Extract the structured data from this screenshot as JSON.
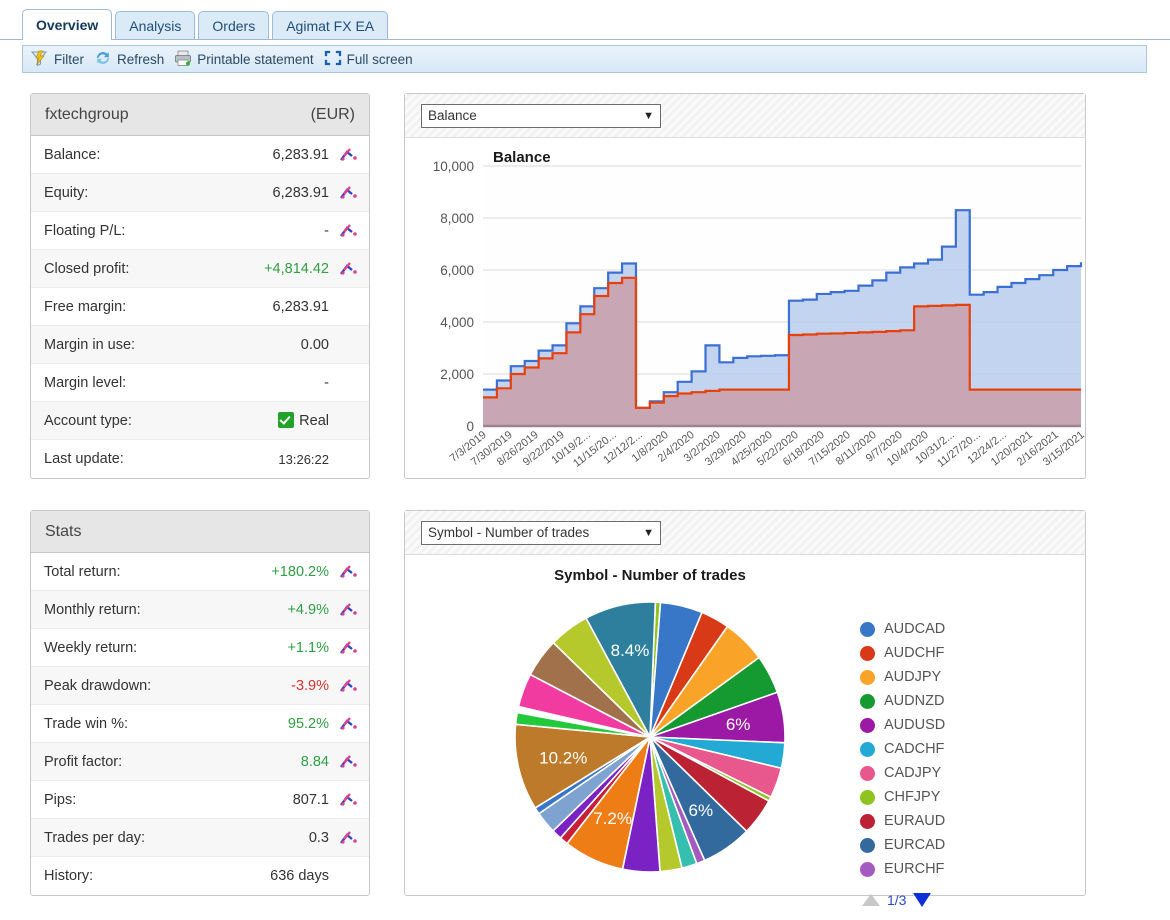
{
  "tabs": [
    {
      "label": "Overview",
      "active": true
    },
    {
      "label": "Analysis",
      "active": false
    },
    {
      "label": "Orders",
      "active": false
    },
    {
      "label": "Agimat FX EA",
      "active": false
    }
  ],
  "toolbar": {
    "filter": "Filter",
    "refresh": "Refresh",
    "printable": "Printable statement",
    "fullscreen": "Full screen"
  },
  "account": {
    "title": "fxtechgroup",
    "currency": "(EUR)",
    "rows": [
      {
        "label": "Balance:",
        "value": "6,283.91",
        "color": "",
        "spark": true
      },
      {
        "label": "Equity:",
        "value": "6,283.91",
        "color": "",
        "spark": true
      },
      {
        "label": "Floating P/L:",
        "value": "-",
        "color": "",
        "spark": true
      },
      {
        "label": "Closed profit:",
        "value": "+4,814.42",
        "color": "green",
        "spark": true
      },
      {
        "label": "Free margin:",
        "value": "6,283.91",
        "color": "",
        "spark": false
      },
      {
        "label": "Margin in use:",
        "value": "0.00",
        "color": "",
        "spark": false
      },
      {
        "label": "Margin level:",
        "value": "-",
        "color": "",
        "spark": false
      },
      {
        "label": "Account type:",
        "value": "Real",
        "color": "",
        "spark": false,
        "check": true
      },
      {
        "label": "Last update:",
        "value": "13:26:22",
        "color": "",
        "spark": false,
        "small": true
      }
    ]
  },
  "stats": {
    "title": "Stats",
    "rows": [
      {
        "label": "Total return:",
        "value": "+180.2%",
        "color": "green",
        "spark": true
      },
      {
        "label": "Monthly return:",
        "value": "+4.9%",
        "color": "green",
        "spark": true
      },
      {
        "label": "Weekly return:",
        "value": "+1.1%",
        "color": "green",
        "spark": true
      },
      {
        "label": "Peak drawdown:",
        "value": "-3.9%",
        "color": "red",
        "spark": true
      },
      {
        "label": "Trade win %:",
        "value": "95.2%",
        "color": "green",
        "spark": true
      },
      {
        "label": "Profit factor:",
        "value": "8.84",
        "color": "green",
        "spark": true
      },
      {
        "label": "Pips:",
        "value": "807.1",
        "color": "",
        "spark": true
      },
      {
        "label": "Trades per day:",
        "value": "0.3",
        "color": "",
        "spark": true
      },
      {
        "label": "History:",
        "value": "636 days",
        "color": "",
        "spark": false
      }
    ]
  },
  "balance_chart_select": "Balance",
  "pie_chart_select": "Symbol - Number of trades",
  "pager": {
    "text": "1/3"
  },
  "chart_data": [
    {
      "type": "area",
      "title": "Balance",
      "xlabel": "",
      "ylabel": "",
      "ylim": [
        0,
        10000
      ],
      "yticks": [
        0,
        2000,
        4000,
        6000,
        8000,
        10000
      ],
      "ytick_labels": [
        "0",
        "2,000",
        "4,000",
        "6,000",
        "8,000",
        "10,000"
      ],
      "grid": true,
      "legend": "none",
      "x": [
        "7/3/2019",
        "7/30/2019",
        "8/26/2019",
        "9/22/2019",
        "10/19/2...",
        "11/15/20...",
        "12/12/2...",
        "1/8/2020",
        "2/4/2020",
        "3/2/2020",
        "3/29/2020",
        "4/25/2020",
        "5/22/2020",
        "6/18/2020",
        "7/15/2020",
        "8/11/2020",
        "9/7/2020",
        "10/4/2020",
        "10/31/2...",
        "11/27/20...",
        "12/24/2...",
        "1/20/2021",
        "2/16/2021",
        "3/15/2021"
      ],
      "series": [
        {
          "name": "Balance",
          "color": "#3b6fd4",
          "fill": "#b9cdee",
          "values": [
            1400,
            1750,
            2300,
            2500,
            2900,
            3100,
            3950,
            4600,
            5300,
            5900,
            6250,
            700,
            950,
            1300,
            1700,
            2100,
            3100,
            2450,
            2620,
            2680,
            2700,
            2720,
            4820,
            4860,
            5080,
            5150,
            5200,
            5400,
            5600,
            5900,
            6100,
            6250,
            6400,
            6900,
            8300,
            5050,
            5150,
            5350,
            5500,
            5650,
            5800,
            6000,
            6150,
            6300
          ]
        },
        {
          "name": "Closed profit",
          "color": "#e8400a",
          "fill": "#c99aa4",
          "values": [
            1100,
            1450,
            2000,
            2250,
            2600,
            2800,
            3600,
            4300,
            5000,
            5500,
            5700,
            700,
            900,
            1150,
            1250,
            1300,
            1350,
            1400,
            1400,
            1400,
            1400,
            1400,
            3500,
            3520,
            3550,
            3560,
            3580,
            3600,
            3620,
            3650,
            3680,
            4600,
            4620,
            4640,
            4660,
            1400,
            1400,
            1400,
            1400,
            1400,
            1400,
            1400,
            1400,
            1400
          ]
        }
      ]
    },
    {
      "type": "pie",
      "title": "Symbol - Number of trades",
      "legend_position": "right",
      "labels": [
        "AUDCAD",
        "AUDCHF",
        "AUDJPY",
        "AUDNZD",
        "AUDUSD",
        "CADCHF",
        "CADJPY",
        "CHFJPY",
        "EURAUD",
        "EURCAD",
        "EURCHF"
      ],
      "colors": [
        "#3876c7",
        "#d83a18",
        "#f9a328",
        "#159a31",
        "#9c19a5",
        "#22a9d4",
        "#e8588c",
        "#8fc31f",
        "#bb2233",
        "#336a9e",
        "#a45bc0"
      ],
      "slices": [
        {
          "label": "",
          "value": 0.6,
          "color": "#8fc31f",
          "display": ""
        },
        {
          "label": "AUDCAD",
          "value": 5.0,
          "color": "#3876c7",
          "display": ""
        },
        {
          "label": "AUDCHF",
          "value": 3.4,
          "color": "#d83a18",
          "display": ""
        },
        {
          "label": "AUDJPY",
          "value": 5.2,
          "color": "#f9a328",
          "display": ""
        },
        {
          "label": "AUDNZD",
          "value": 4.6,
          "color": "#159a31",
          "display": ""
        },
        {
          "label": "AUDUSD",
          "value": 6.0,
          "color": "#9c19a5",
          "display": "6%"
        },
        {
          "label": "CADCHF",
          "value": 3.0,
          "color": "#22a9d4",
          "display": ""
        },
        {
          "label": "CADJPY",
          "value": 3.6,
          "color": "#e8588c",
          "display": ""
        },
        {
          "label": "",
          "value": 0.5,
          "color": "#8fc31f",
          "display": ""
        },
        {
          "label": "EURAUD",
          "value": 4.4,
          "color": "#bb2233",
          "display": ""
        },
        {
          "label": "EURCAD",
          "value": 6.0,
          "color": "#336a9e",
          "display": "6%"
        },
        {
          "label": "EURCHF",
          "value": 1.0,
          "color": "#a45bc0",
          "display": ""
        },
        {
          "label": "",
          "value": 1.8,
          "color": "#36bfae",
          "display": ""
        },
        {
          "label": "",
          "value": 2.6,
          "color": "#b5c92c",
          "display": ""
        },
        {
          "label": "",
          "value": 4.4,
          "color": "#7b22c4",
          "display": ""
        },
        {
          "label": "",
          "value": 7.2,
          "color": "#ef7d16",
          "display": "7.2%"
        },
        {
          "label": "",
          "value": 1.0,
          "color": "#c71f3a",
          "display": ""
        },
        {
          "label": "",
          "value": 1.2,
          "color": "#7b22c4",
          "display": ""
        },
        {
          "label": "",
          "value": 2.6,
          "color": "#7fa3d1",
          "display": ""
        },
        {
          "label": "",
          "value": 0.8,
          "color": "#3876c7",
          "display": ""
        },
        {
          "label": "",
          "value": 10.2,
          "color": "#bc7a2a",
          "display": "10.2%"
        },
        {
          "label": "",
          "value": 1.4,
          "color": "#22c93a",
          "display": ""
        },
        {
          "label": "",
          "value": 0.7,
          "color": "#ffffff",
          "display": ""
        },
        {
          "label": "",
          "value": 4.0,
          "color": "#f23ba0",
          "display": ""
        },
        {
          "label": "",
          "value": 4.6,
          "color": "#a0714a",
          "display": ""
        },
        {
          "label": "",
          "value": 4.8,
          "color": "#b5c92c",
          "display": ""
        },
        {
          "label": "",
          "value": 8.4,
          "color": "#2e7f9e",
          "display": "8.4%"
        }
      ]
    }
  ]
}
